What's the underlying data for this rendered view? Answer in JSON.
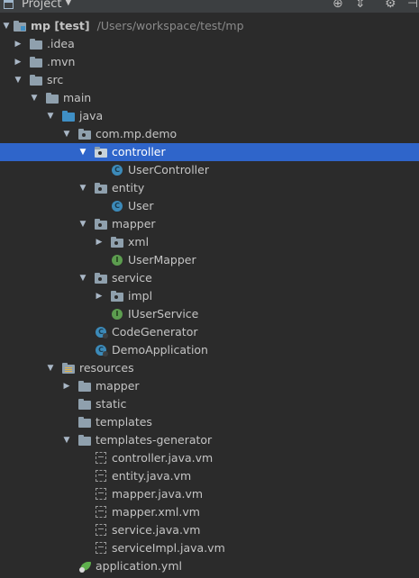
{
  "toolbar": {
    "title": "Project",
    "dropdown_glyph": "▼",
    "icons": [
      "crosshair-icon",
      "collapse-icon",
      "gear-icon",
      "hide-icon"
    ]
  },
  "tree": {
    "root": {
      "name": "mp [test]",
      "path": "/Users/workspace/test/mp"
    },
    "idea": ".idea",
    "mvn": ".mvn",
    "src": "src",
    "main": "main",
    "java": "java",
    "package": "com.mp.demo",
    "controller": "controller",
    "user_controller": "UserController",
    "entity": "entity",
    "user": "User",
    "mapper": "mapper",
    "xml": "xml",
    "user_mapper": "UserMapper",
    "service": "service",
    "impl": "impl",
    "iuser_service": "IUserService",
    "code_generator": "CodeGenerator",
    "demo_application": "DemoApplication",
    "resources": "resources",
    "res_mapper": "mapper",
    "static": "static",
    "templates": "templates",
    "templates_generator": "templates-generator",
    "controller_vm": "controller.java.vm",
    "entity_vm": "entity.java.vm",
    "mapper_vm": "mapper.java.vm",
    "mapper_xml_vm": "mapper.xml.vm",
    "service_vm": "service.java.vm",
    "service_impl_vm": "serviceImpl.java.vm",
    "application_yml": "application.yml"
  },
  "glyphs": {
    "expanded": "▼",
    "collapsed": "▶",
    "class_letter": "C",
    "interface_letter": "I"
  },
  "colors": {
    "background": "#2b2b2b",
    "selection": "#2f65ca",
    "text": "#c4c4c4",
    "path_text": "#8a8a8a",
    "source_folder": "#3f8fc5",
    "class_icon": "#3c8ab9",
    "interface_icon": "#5c9d4f"
  }
}
